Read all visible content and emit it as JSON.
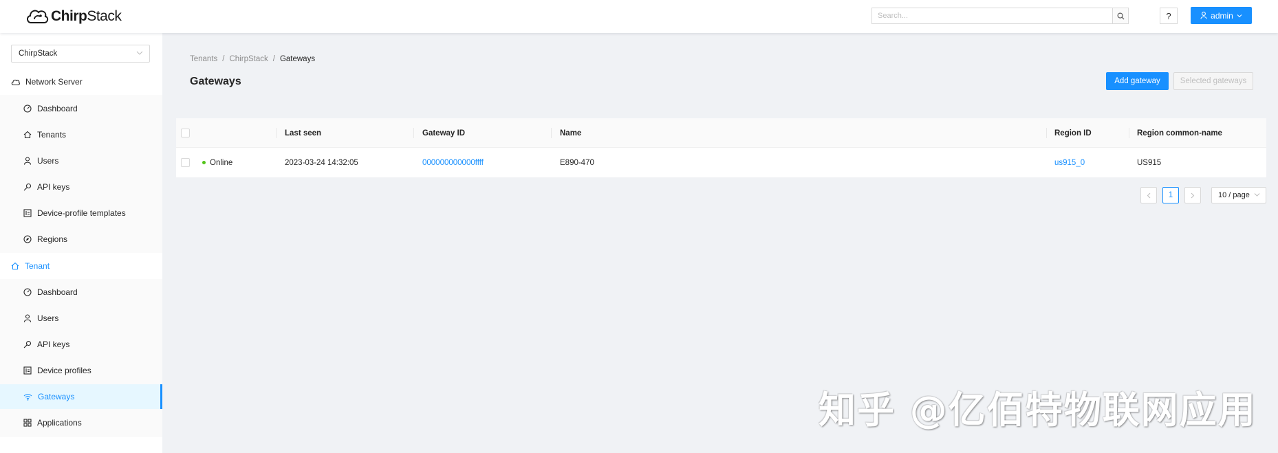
{
  "header": {
    "logo_text_bold": "Chirp",
    "logo_text_regular": "Stack",
    "search_placeholder": "Search...",
    "help_label": "?",
    "user_label": "admin"
  },
  "sidebar": {
    "tenant_select": "ChirpStack",
    "network_server": {
      "label": "Network Server",
      "items": [
        {
          "label": "Dashboard",
          "icon": "dashboard-icon"
        },
        {
          "label": "Tenants",
          "icon": "home-icon"
        },
        {
          "label": "Users",
          "icon": "user-icon"
        },
        {
          "label": "API keys",
          "icon": "key-icon"
        },
        {
          "label": "Device-profile templates",
          "icon": "profile-icon"
        },
        {
          "label": "Regions",
          "icon": "compass-icon"
        }
      ]
    },
    "tenant": {
      "label": "Tenant",
      "items": [
        {
          "label": "Dashboard",
          "icon": "dashboard-icon"
        },
        {
          "label": "Users",
          "icon": "user-icon"
        },
        {
          "label": "API keys",
          "icon": "key-icon"
        },
        {
          "label": "Device profiles",
          "icon": "profile-icon"
        },
        {
          "label": "Gateways",
          "icon": "wifi-icon",
          "selected": true
        },
        {
          "label": "Applications",
          "icon": "apps-icon"
        }
      ]
    }
  },
  "breadcrumb": [
    "Tenants",
    "ChirpStack",
    "Gateways"
  ],
  "page": {
    "title": "Gateways",
    "add_button": "Add gateway",
    "selected_button": "Selected gateways"
  },
  "table": {
    "columns": [
      "",
      "Last seen",
      "Gateway ID",
      "Name",
      "Region ID",
      "Region common-name"
    ],
    "rows": [
      {
        "status": "Online",
        "last_seen": "2023-03-24 14:32:05",
        "gateway_id": "000000000000ffff",
        "name": "E890-470",
        "region_id": "us915_0",
        "region_common_name": "US915"
      }
    ]
  },
  "pagination": {
    "current_page": "1",
    "page_size": "10 / page"
  },
  "watermark": "知乎 @亿佰特物联网应用",
  "colors": {
    "primary": "#1890ff",
    "online": "#52c41a",
    "background": "#f0f2f5"
  }
}
